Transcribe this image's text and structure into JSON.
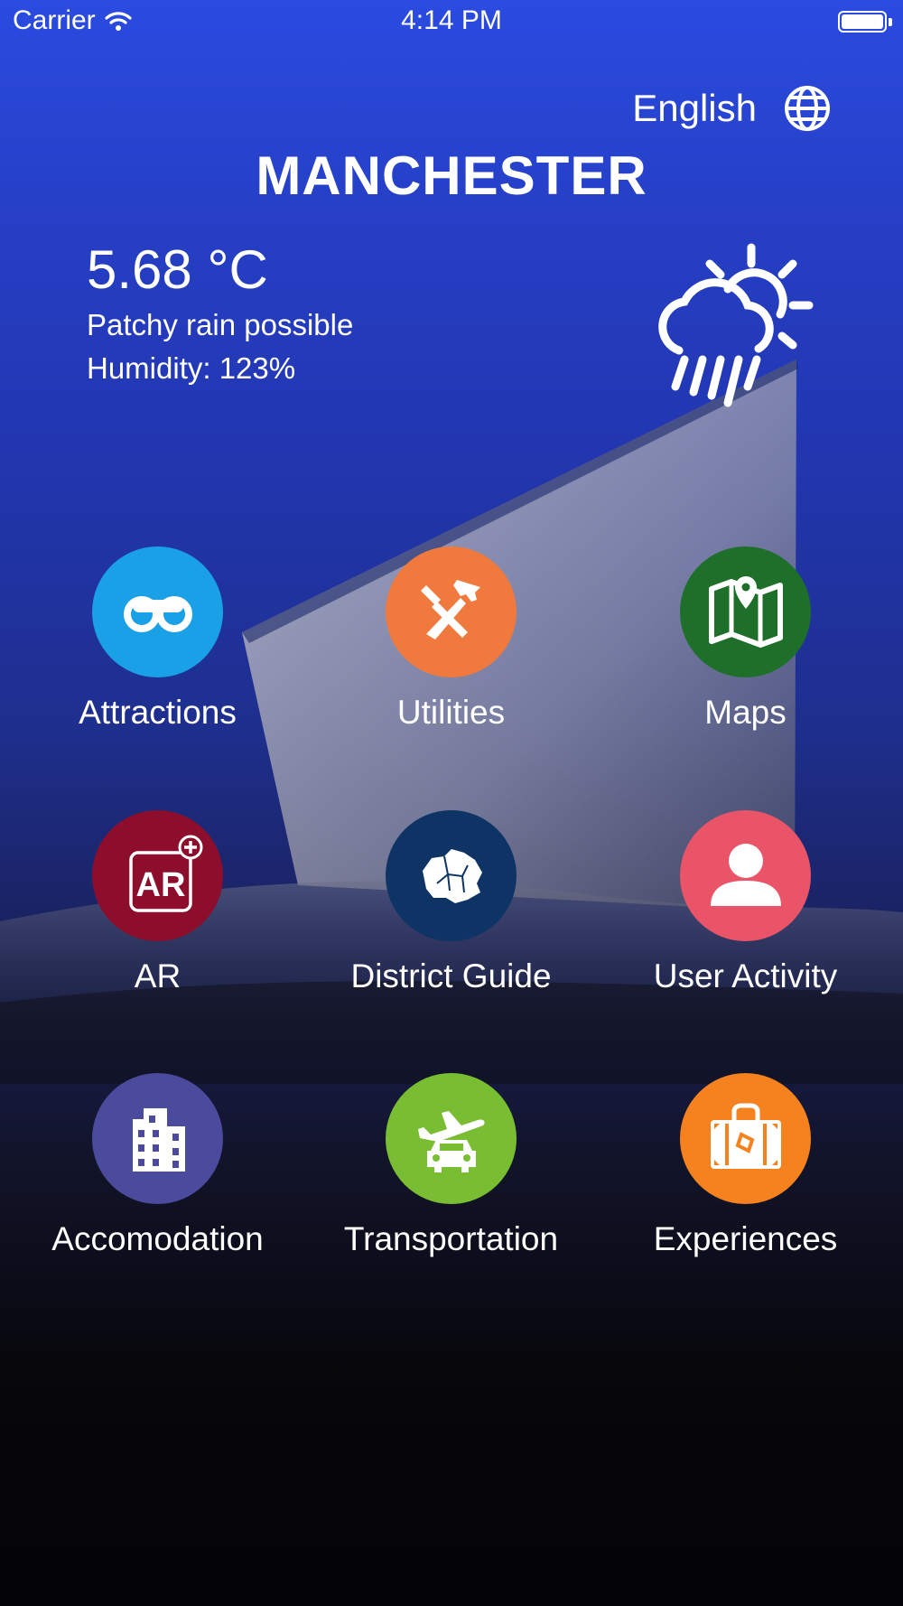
{
  "status_bar": {
    "carrier": "Carrier",
    "time": "4:14 PM"
  },
  "language": {
    "label": "English",
    "icon": "globe-icon"
  },
  "city": {
    "name": "MANCHESTER"
  },
  "weather": {
    "temperature": "5.68 °C",
    "condition": "Patchy rain possible",
    "humidity": "Humidity: 123%",
    "icon": "rain-sun-icon"
  },
  "menu": [
    {
      "label": "Attractions",
      "icon": "binoculars-icon",
      "color": "#19a0e6"
    },
    {
      "label": "Utilities",
      "icon": "tools-icon",
      "color": "#f07a3e"
    },
    {
      "label": "Maps",
      "icon": "map-icon",
      "color": "#1e6f2a"
    },
    {
      "label": "AR",
      "icon": "ar-icon",
      "color": "#8c0e2c"
    },
    {
      "label": "District Guide",
      "icon": "district-map-icon",
      "color": "#0e3466"
    },
    {
      "label": "User Activity",
      "icon": "user-icon",
      "color": "#ea5468"
    },
    {
      "label": "Accomodation",
      "icon": "building-icon",
      "color": "#4b4a9c"
    },
    {
      "label": "Transportation",
      "icon": "plane-car-icon",
      "color": "#78bd32"
    },
    {
      "label": "Experiences",
      "icon": "suitcase-icon",
      "color": "#f5821e"
    }
  ]
}
